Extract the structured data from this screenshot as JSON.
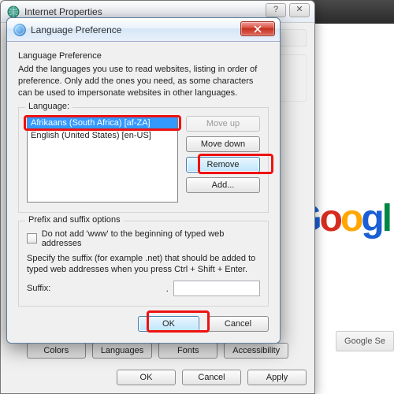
{
  "parent": {
    "title": "Internet Properties",
    "sys": {
      "help": "?",
      "close": "✕"
    },
    "buttons": {
      "colors": "Colors",
      "languages": "Languages",
      "fonts": "Fonts",
      "accessibility": "Accessibility",
      "ok": "OK",
      "cancel": "Cancel",
      "apply": "Apply"
    }
  },
  "dialog": {
    "title": "Language Preference",
    "heading": "Language Preference",
    "description": "Add the languages you use to read websites, listing in order of preference. Only add the ones you need, as some characters can be used to impersonate websites in other languages.",
    "lang_legend": "Language:",
    "languages": [
      "Afrikaans (South Africa) [af-ZA]",
      "English (United States) [en-US]"
    ],
    "buttons": {
      "moveup": "Move up",
      "movedown": "Move down",
      "remove": "Remove",
      "add": "Add..."
    },
    "prefix": {
      "legend": "Prefix and suffix options",
      "checkbox_label": "Do not add 'www' to the beginning of typed web addresses",
      "suffix_desc": "Specify the suffix (for example .net) that should be added to typed web addresses when you press Ctrl + Shift + Enter.",
      "suffix_label": "Suffix:",
      "suffix_value": ""
    },
    "footer": {
      "ok": "OK",
      "cancel": "Cancel"
    }
  },
  "background": {
    "google_btn": "Google Se"
  }
}
